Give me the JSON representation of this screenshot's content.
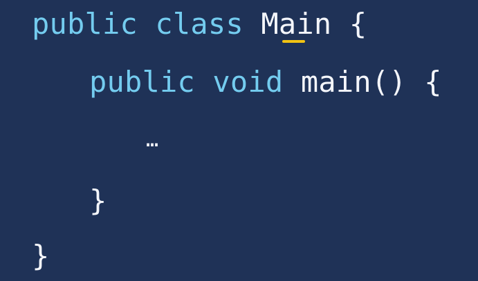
{
  "code": {
    "line_1": {
      "kw_public": "public",
      "kw_class": "class",
      "class_name": "Main",
      "open_brace": "{"
    },
    "line_2": {
      "kw_public": "public",
      "kw_void": "void",
      "method_name": "main()",
      "open_brace": "{"
    },
    "line_3": {
      "ellipsis": "…"
    },
    "line_4": {
      "close_brace": "}"
    },
    "line_5": {
      "close_brace": "}"
    }
  },
  "colors": {
    "background": "#1f3257",
    "keyword": "#74ccef",
    "plain_text": "#f4f6fb",
    "highlight_underline": "#f2c313"
  }
}
